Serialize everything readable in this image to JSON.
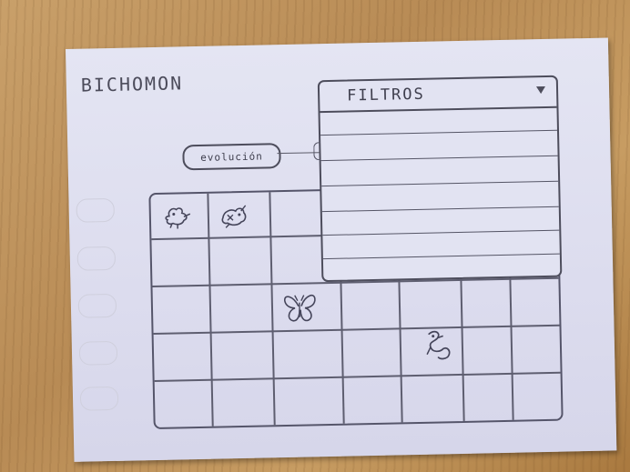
{
  "app": {
    "title": "BICHOMON"
  },
  "toolbar": {
    "evolution_label": "evolución"
  },
  "filters": {
    "title": "FILTROS",
    "option_count_rows": 6
  },
  "sidebar": {
    "items": [
      "",
      "",
      "",
      "",
      "",
      ""
    ]
  },
  "grid": {
    "columns": 7,
    "rows": 5,
    "sprites": [
      {
        "name": "creature-sprite-1"
      },
      {
        "name": "creature-sprite-2"
      },
      {
        "name": "creature-sprite-3"
      },
      {
        "name": "creature-sprite-4"
      }
    ]
  },
  "colors": {
    "ink": "#4d4d5c",
    "paper": "#dfe0f0",
    "table": "#b88b55"
  }
}
